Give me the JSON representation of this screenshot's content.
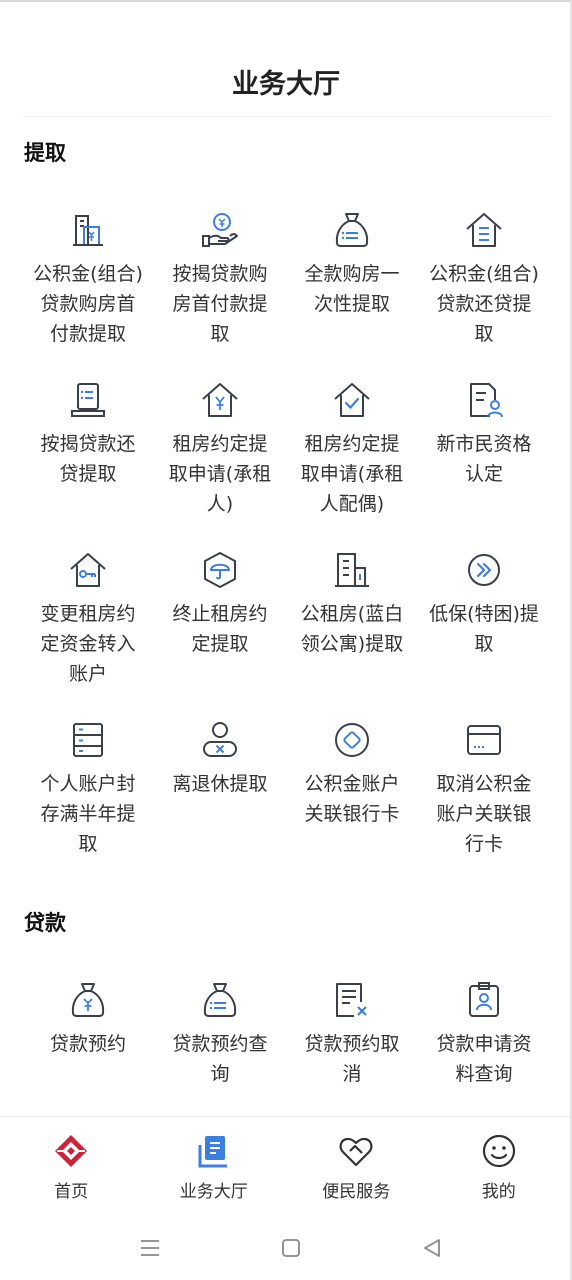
{
  "header": {
    "title": "业务大厅"
  },
  "sections": [
    {
      "title": "提取",
      "items": [
        {
          "label": "公积金(组合)贷款购房首付款提取",
          "icon": "building-yen-icon"
        },
        {
          "label": "按揭贷款购房首付款提取",
          "icon": "hand-coin-icon"
        },
        {
          "label": "全款购房一次性提取",
          "icon": "money-bag-icon"
        },
        {
          "label": "公积金(组合)贷款还贷提取",
          "icon": "house-list-icon"
        },
        {
          "label": "按揭贷款还贷提取",
          "icon": "document-stand-icon"
        },
        {
          "label": "租房约定提取申请(承租人)",
          "icon": "house-yen-icon"
        },
        {
          "label": "租房约定提取申请(承租人配偶)",
          "icon": "house-check-icon"
        },
        {
          "label": "新市民资格认定",
          "icon": "document-person-icon"
        },
        {
          "label": "变更租房约定资金转入账户",
          "icon": "house-key-icon"
        },
        {
          "label": "终止租房约定提取",
          "icon": "hexagon-umbrella-icon"
        },
        {
          "label": "公租房(蓝白领公寓)提取",
          "icon": "apartment-icon"
        },
        {
          "label": "低保(特困)提取",
          "icon": "double-chevron-icon"
        },
        {
          "label": "个人账户封存满半年提取",
          "icon": "server-stack-icon"
        },
        {
          "label": "离退休提取",
          "icon": "person-cancel-icon"
        },
        {
          "label": "公积金账户关联银行卡",
          "icon": "circle-diamond-icon"
        },
        {
          "label": "取消公积金账户关联银行卡",
          "icon": "bank-card-icon"
        }
      ]
    },
    {
      "title": "贷款",
      "items": [
        {
          "label": "贷款预约",
          "icon": "money-bag-yen-icon"
        },
        {
          "label": "贷款预约查询",
          "icon": "money-bag-list-icon"
        },
        {
          "label": "贷款预约取消",
          "icon": "document-cancel-icon"
        },
        {
          "label": "贷款申请资料查询",
          "icon": "id-badge-icon"
        }
      ]
    }
  ],
  "tabbar": [
    {
      "label": "首页",
      "icon": "home-logo-icon",
      "active": false
    },
    {
      "label": "业务大厅",
      "icon": "business-hall-icon",
      "active": true
    },
    {
      "label": "便民服务",
      "icon": "heart-handshake-icon",
      "active": false
    },
    {
      "label": "我的",
      "icon": "smiley-profile-icon",
      "active": false
    }
  ],
  "colors": {
    "icon_stroke": "#3a3f4b",
    "icon_accent": "#3d7fe0",
    "logo_red": "#c9243a",
    "tab_active_blue": "#3d7fe0"
  }
}
